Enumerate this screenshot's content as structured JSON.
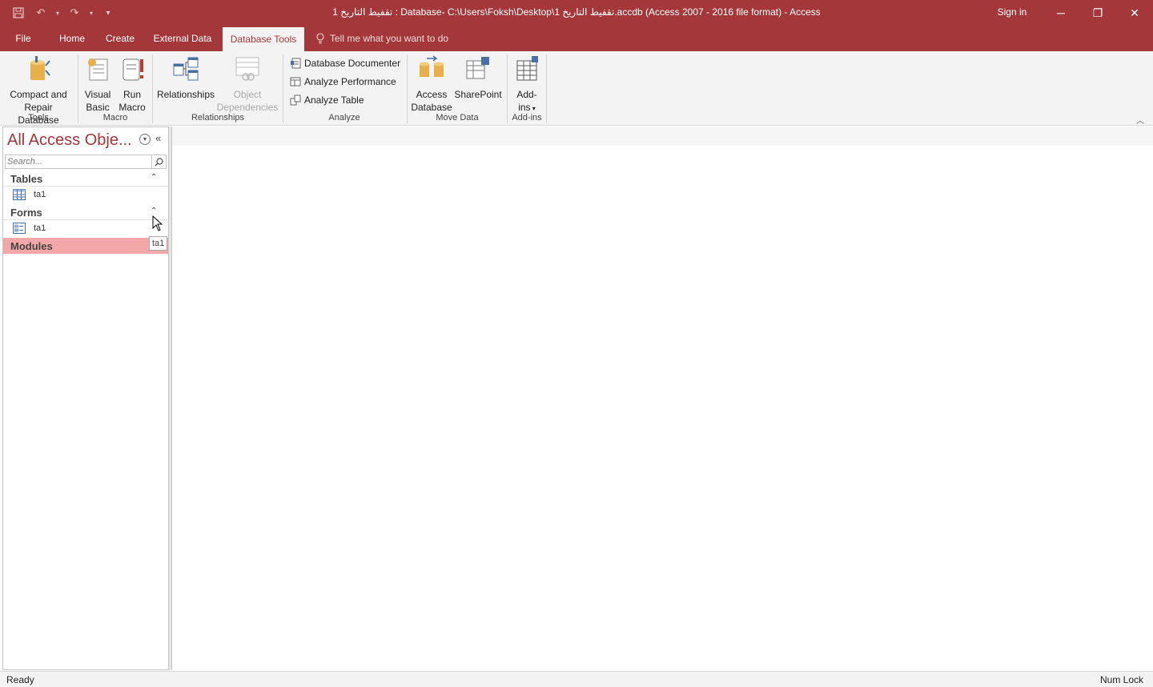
{
  "window": {
    "title": "تقفيط التاريخ 1 : Database- C:\\Users\\Foksh\\Desktop\\تقفيط التاريخ 1.accdb (Access 2007 - 2016 file format)  -  Access",
    "sign_in": "Sign in",
    "controls": {
      "minimize": "─",
      "restore": "❐",
      "close": "✕"
    },
    "qat": {
      "save": "save-icon",
      "undo": "undo-icon",
      "redo": "redo-icon",
      "customize": "customize-icon"
    }
  },
  "tabs": [
    {
      "label": "File"
    },
    {
      "label": "Home"
    },
    {
      "label": "Create"
    },
    {
      "label": "External Data"
    },
    {
      "label": "Database Tools",
      "active": true
    }
  ],
  "tell_me": "Tell me what you want to do",
  "ribbon": {
    "tools": {
      "compact_line1": "Compact and",
      "compact_line2": "Repair Database",
      "group": "Tools"
    },
    "macro": {
      "vb_line1": "Visual",
      "vb_line2": "Basic",
      "run_line1": "Run",
      "run_line2": "Macro",
      "group": "Macro"
    },
    "relationships": {
      "relationships": "Relationships",
      "objdep_line1": "Object",
      "objdep_line2": "Dependencies",
      "group": "Relationships"
    },
    "analyze": {
      "documenter": "Database Documenter",
      "performance": "Analyze Performance",
      "table": "Analyze Table",
      "group": "Analyze"
    },
    "move_data": {
      "access_line1": "Access",
      "access_line2": "Database",
      "sharepoint": "SharePoint",
      "group": "Move Data"
    },
    "addins": {
      "line1": "Add-",
      "line2": "ins",
      "group": "Add-ins"
    }
  },
  "nav": {
    "header": "All Access Obje...",
    "search_placeholder": "Search...",
    "sections": [
      {
        "label": "Tables",
        "items": [
          {
            "label": "ta1"
          }
        ]
      },
      {
        "label": "Forms",
        "items": [
          {
            "label": "ta1"
          }
        ]
      },
      {
        "label": "Modules",
        "items": []
      }
    ],
    "tooltip": "ta1"
  },
  "status": {
    "left": "Ready",
    "right": "Num Lock"
  },
  "colors": {
    "accent": "#a4373a",
    "highlight": "#f4a7a9",
    "ribbon_bg": "#f3f3f3"
  }
}
